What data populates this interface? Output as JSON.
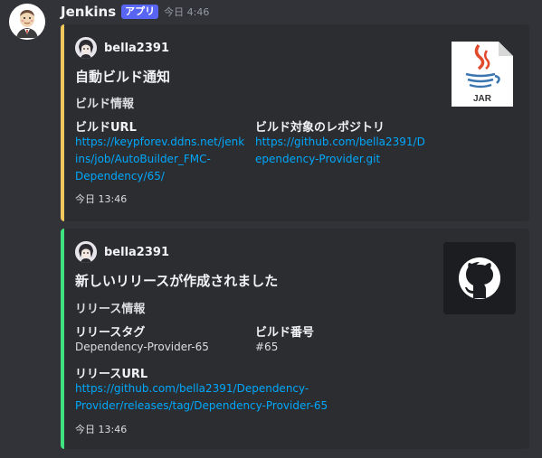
{
  "colors": {
    "background": "#323339",
    "embed_background": "#2b2d31",
    "embed1_accent": "#f0c75e",
    "embed2_accent": "#3ee27f",
    "link": "#00a8fc",
    "app_badge": "#5865f2"
  },
  "message": {
    "author": "Jenkins",
    "app_badge": "アプリ",
    "timestamp": "今日 4:46",
    "avatar_icon": "jenkins-butler-icon"
  },
  "embeds": [
    {
      "author": "bella2391",
      "title": "自動ビルド通知",
      "description": "ビルド情報",
      "fields": [
        {
          "name": "ビルドURL",
          "value_lines": [
            "https://keypforev.ddns.net/jenk",
            "ins/job/AutoBuilder_FMC-",
            "Dependency/65/"
          ]
        },
        {
          "name": "ビルド対象のレポジトリ",
          "value_lines": [
            "https://github.com/bella2391/D",
            "ependency-Provider.git"
          ]
        }
      ],
      "footer": "今日 13:46",
      "thumbnail_icon": "jar-file-icon",
      "thumbnail_label": "JAR"
    },
    {
      "author": "bella2391",
      "title": "新しいリリースが作成されました",
      "description": "リリース情報",
      "fields": [
        {
          "name": "リリースタグ",
          "value": "Dependency-Provider-65"
        },
        {
          "name": "ビルド番号",
          "value": "#65"
        },
        {
          "name": "リリースURL",
          "value_lines": [
            "https://github.com/bella2391/Dependency-",
            "Provider/releases/tag/Dependency-Provider-65"
          ]
        }
      ],
      "footer": "今日 13:46",
      "thumbnail_icon": "github-logo-icon"
    }
  ]
}
